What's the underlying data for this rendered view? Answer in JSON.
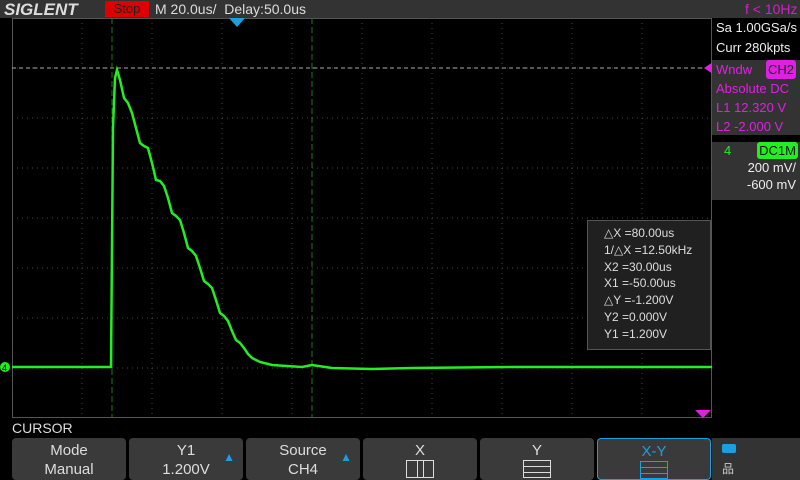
{
  "header": {
    "brand": "SIGLENT",
    "run_state": "Stop",
    "timebase": "M 20.0us/",
    "delay": "Delay:50.0us",
    "trigger_freq": "f < 10Hz"
  },
  "acquisition": {
    "sample_rate": "Sa 1.00GSa/s",
    "memory": "Curr 280kpts"
  },
  "window": {
    "label": "Wndw",
    "channel": "CH2",
    "mode": "Absolute DC",
    "l1": "L1  12.320 V",
    "l2": "L2  -2.000 V"
  },
  "channel": {
    "number": "4",
    "coupling": "DC1M",
    "scale": "200 mV/",
    "offset": "-600 mV"
  },
  "cursor_readout": [
    "△X =80.00us",
    "1/△X =12.50kHz",
    "X2 =30.00us",
    "X1 =-50.00us",
    "△Y =-1.200V",
    "Y2 =0.000V",
    "Y1 =1.200V"
  ],
  "menu": {
    "title": "CURSOR",
    "buttons": [
      {
        "top": "Mode",
        "bottom": "Manual"
      },
      {
        "top": "Y1",
        "bottom": "1.200V"
      },
      {
        "top": "Source",
        "bottom": "CH4"
      },
      {
        "top": "X"
      },
      {
        "top": "Y"
      },
      {
        "top": "X-Y"
      }
    ]
  },
  "colors": {
    "trace": "#22ee22",
    "accent": "#1aa0e0",
    "window": "#e020e0"
  }
}
